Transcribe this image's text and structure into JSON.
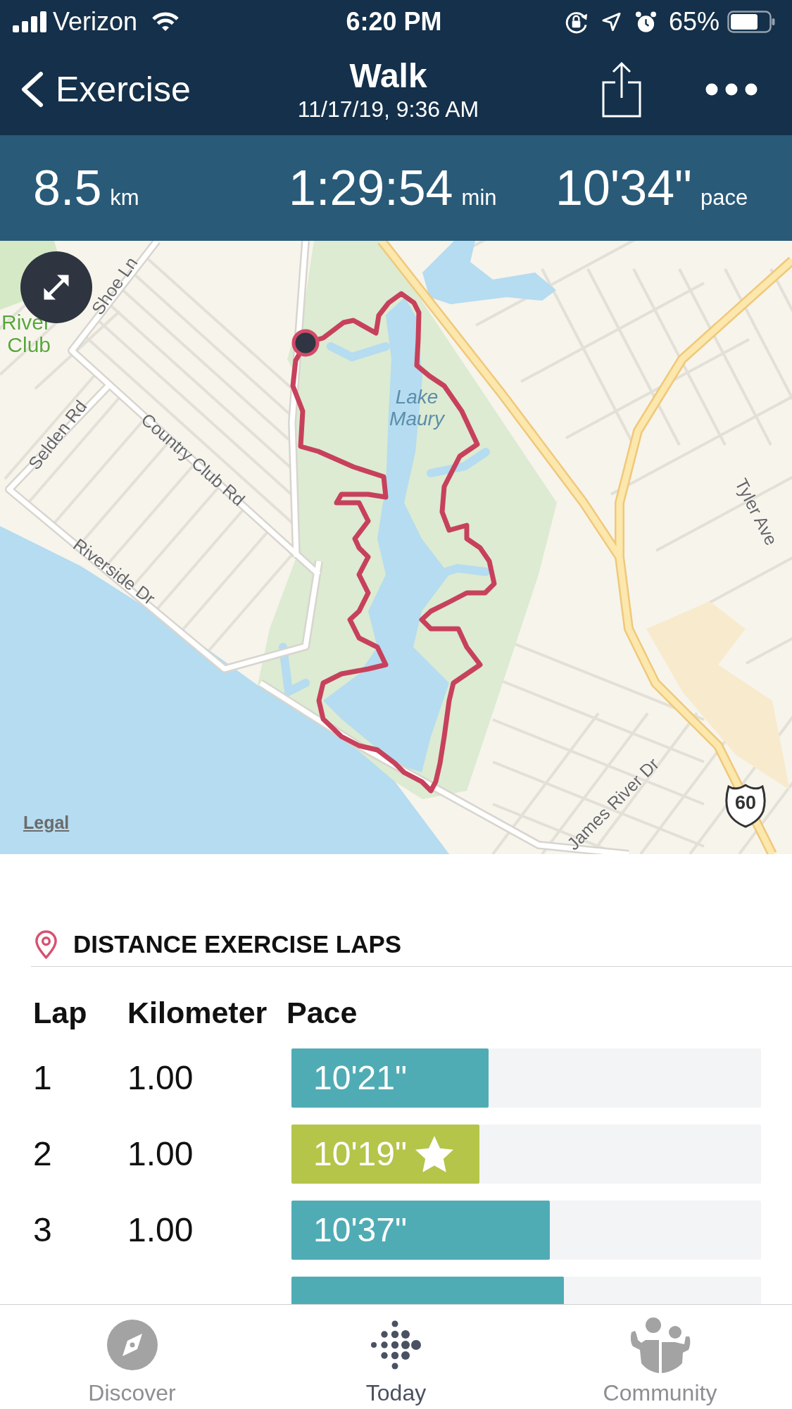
{
  "status_bar": {
    "carrier": "Verizon",
    "time": "6:20 PM",
    "battery": "65%"
  },
  "nav_bar": {
    "back_label": "Exercise",
    "title": "Walk",
    "subtitle": "11/17/19, 9:36 AM"
  },
  "summary": [
    {
      "value": "8.5",
      "unit": "km"
    },
    {
      "value": "1:29:54",
      "unit": "min"
    },
    {
      "value": "10'34\"",
      "unit": "pace"
    }
  ],
  "map": {
    "labels": [
      {
        "text": "Shoe Ln",
        "kind": "road"
      },
      {
        "text": "River Club",
        "kind": "park"
      },
      {
        "text": "Lake Maury",
        "kind": "water"
      },
      {
        "text": "Selden Rd",
        "kind": "road"
      },
      {
        "text": "Country Club Rd",
        "kind": "road"
      },
      {
        "text": "Tyler Ave",
        "kind": "road"
      },
      {
        "text": "Riverside Dr",
        "kind": "road"
      },
      {
        "text": "James River Dr",
        "kind": "road"
      },
      {
        "text": "60",
        "kind": "shield"
      }
    ],
    "legal_link": "Legal"
  },
  "laps": {
    "title": "DISTANCE EXERCISE LAPS",
    "columns": [
      "Lap",
      "Kilometer",
      "Pace"
    ],
    "rows": [
      {
        "lap": "1",
        "distance": "1.00",
        "pace": "10'21\"",
        "level": 0.42,
        "best": false
      },
      {
        "lap": "2",
        "distance": "1.00",
        "pace": "10'19\"",
        "level": 0.4,
        "best": true
      },
      {
        "lap": "3",
        "distance": "1.00",
        "pace": "10'37\"",
        "level": 0.55,
        "best": false
      },
      {
        "level": 0.58,
        "best": false
      }
    ]
  },
  "tab_bar": [
    {
      "label": "Discover",
      "selected": false
    },
    {
      "label": "Today",
      "selected": true
    },
    {
      "label": "Community",
      "selected": false
    }
  ]
}
